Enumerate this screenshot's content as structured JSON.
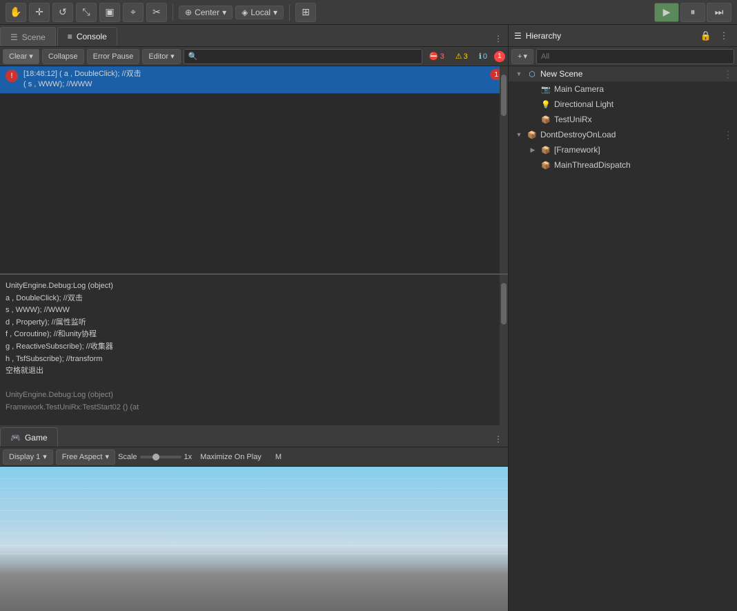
{
  "toolbar": {
    "tools": [
      {
        "name": "hand-tool",
        "icon": "✋"
      },
      {
        "name": "move-tool",
        "icon": "✛"
      },
      {
        "name": "rotate-tool",
        "icon": "↺"
      },
      {
        "name": "scale-tool",
        "icon": "⤡"
      },
      {
        "name": "rect-tool",
        "icon": "▣"
      },
      {
        "name": "transform-tool",
        "icon": "✦"
      },
      {
        "name": "multi-tool",
        "icon": "✂"
      }
    ],
    "pivot_label": "Center",
    "space_label": "Local",
    "grid_btn": "⊞"
  },
  "play_controls": {
    "play": "▶",
    "pause": "⏸",
    "step": "⏭"
  },
  "console": {
    "tab_scene": "Scene",
    "tab_console": "Console",
    "clear_label": "Clear",
    "collapse_label": "Collapse",
    "error_pause_label": "Error Pause",
    "editor_label": "Editor",
    "badge_error_count": "3",
    "badge_warning_count": "3",
    "badge_info_count": "0",
    "badge_overflow": "1",
    "error_icon": "!",
    "debug_icon": "i",
    "entry1": {
      "type": "error",
      "text": "[18:48:12] ( a , DoubleClick);   //双击\n( s , WWW);                    //WWW",
      "count": "1"
    },
    "detail_lines": [
      "a , DoubleClick);      //双击",
      "s , WWW);              //WWW",
      "d , Property);         //属性监听",
      "f , Coroutine);        //和unity协程",
      "g , ReactiveSubscribe); //收集器",
      "h , TsfSubscribe);     //transform",
      "空格就退出",
      "",
      "UnityEngine.Debug:Log (object)",
      "Framework.TestUniRx:TestStart02 () (at"
    ],
    "header_text": "UnityEngine.Debug:Log (object)"
  },
  "game": {
    "tab_label": "Game",
    "tab_icon": "🎮",
    "display_label": "Display 1",
    "aspect_label": "Free Aspect",
    "scale_label": "Scale",
    "scale_value": "1x",
    "maximize_label": "Maximize On Play",
    "mute_label": "M"
  },
  "hierarchy": {
    "title": "Hierarchy",
    "title_icon": "☰",
    "lock_icon": "🔒",
    "menu_icon": "⋮",
    "add_label": "+",
    "search_placeholder": "All",
    "add_menu_arrow": "▼",
    "new_scene_name": "New Scene",
    "scene_menu": "⋮",
    "items": [
      {
        "name": "Main Camera",
        "type": "camera",
        "icon": "📷",
        "indent": 1,
        "expanded": false
      },
      {
        "name": "Directional Light",
        "type": "light",
        "icon": "💡",
        "indent": 1,
        "expanded": false
      },
      {
        "name": "TestUniRx",
        "type": "script",
        "icon": "📦",
        "indent": 1,
        "expanded": false
      },
      {
        "name": "DontDestroyOnLoad",
        "type": "prefab",
        "icon": "📦",
        "indent": 0,
        "expanded": true,
        "menu": "⋮"
      },
      {
        "name": "[Framework]",
        "type": "prefab",
        "icon": "📦",
        "indent": 1,
        "expanded": false,
        "has_expand": true
      },
      {
        "name": "MainThreadDispatch",
        "type": "script",
        "icon": "📦",
        "indent": 1,
        "expanded": false
      }
    ]
  }
}
